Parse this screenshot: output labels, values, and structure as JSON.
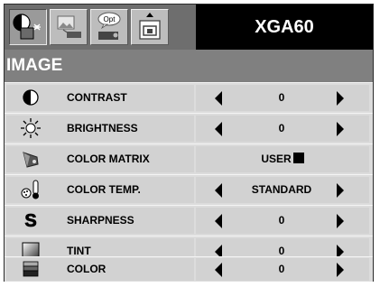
{
  "header": {
    "model": "XGA60",
    "tabs": [
      {
        "icon": "image-adjust-icon",
        "active": true,
        "text": ""
      },
      {
        "icon": "picture-setting-icon",
        "active": false,
        "text": ""
      },
      {
        "icon": "option-icon",
        "active": false,
        "text": "Opt"
      },
      {
        "icon": "screen-setup-icon",
        "active": false,
        "text": ""
      }
    ]
  },
  "section": {
    "title": "IMAGE"
  },
  "rows": [
    {
      "label": "CONTRAST",
      "icon": "contrast-icon",
      "value": "0",
      "arrows": true
    },
    {
      "label": "BRIGHTNESS",
      "icon": "brightness-icon",
      "value": "0",
      "arrows": true
    },
    {
      "label": "COLOR MATRIX",
      "icon": "color-matrix-icon",
      "value": "USER",
      "arrows": false
    },
    {
      "label": "COLOR TEMP.",
      "icon": "color-temp-icon",
      "value": "STANDARD",
      "arrows": true
    },
    {
      "label": "SHARPNESS",
      "icon": "sharpness-icon",
      "value": "0",
      "arrows": true
    },
    {
      "label": "TINT",
      "icon": "tint-icon",
      "value": "0",
      "arrows": true
    },
    {
      "label": "COLOR",
      "icon": "color-icon",
      "value": "0",
      "arrows": true
    }
  ]
}
